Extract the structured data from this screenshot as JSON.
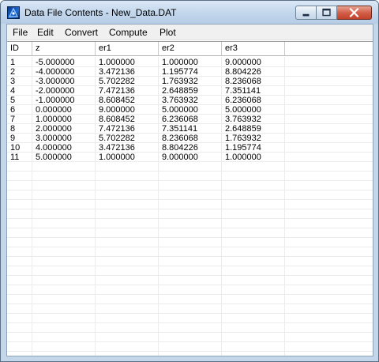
{
  "window": {
    "title": "Data File Contents - New_Data.DAT"
  },
  "menu": [
    "File",
    "Edit",
    "Convert",
    "Compute",
    "Plot"
  ],
  "table": {
    "columns": [
      "ID",
      "z",
      "er1",
      "er2",
      "er3"
    ],
    "rows": [
      [
        "1",
        "-5.000000",
        "1.000000",
        "1.000000",
        "9.000000"
      ],
      [
        "2",
        "-4.000000",
        "3.472136",
        "1.195774",
        "8.804226"
      ],
      [
        "3",
        "-3.000000",
        "5.702282",
        "1.763932",
        "8.236068"
      ],
      [
        "4",
        "-2.000000",
        "7.472136",
        "2.648859",
        "7.351141"
      ],
      [
        "5",
        "-1.000000",
        "8.608452",
        "3.763932",
        "6.236068"
      ],
      [
        "6",
        "0.000000",
        "9.000000",
        "5.000000",
        "5.000000"
      ],
      [
        "7",
        "1.000000",
        "8.608452",
        "6.236068",
        "3.763932"
      ],
      [
        "8",
        "2.000000",
        "7.472136",
        "7.351141",
        "2.648859"
      ],
      [
        "9",
        "3.000000",
        "5.702282",
        "8.236068",
        "1.763932"
      ],
      [
        "10",
        "4.000000",
        "3.472136",
        "8.804226",
        "1.195774"
      ],
      [
        "11",
        "5.000000",
        "1.000000",
        "9.000000",
        "1.000000"
      ]
    ]
  },
  "icons": {
    "app": "app-icon",
    "minimize": "minimize-icon",
    "maximize": "maximize-icon",
    "close": "close-icon"
  },
  "colors": {
    "title_bar": "#c4d7ea",
    "close_button": "#c7432d",
    "menu_bar": "#f0f0f0",
    "grid_background": "#ffffff"
  }
}
